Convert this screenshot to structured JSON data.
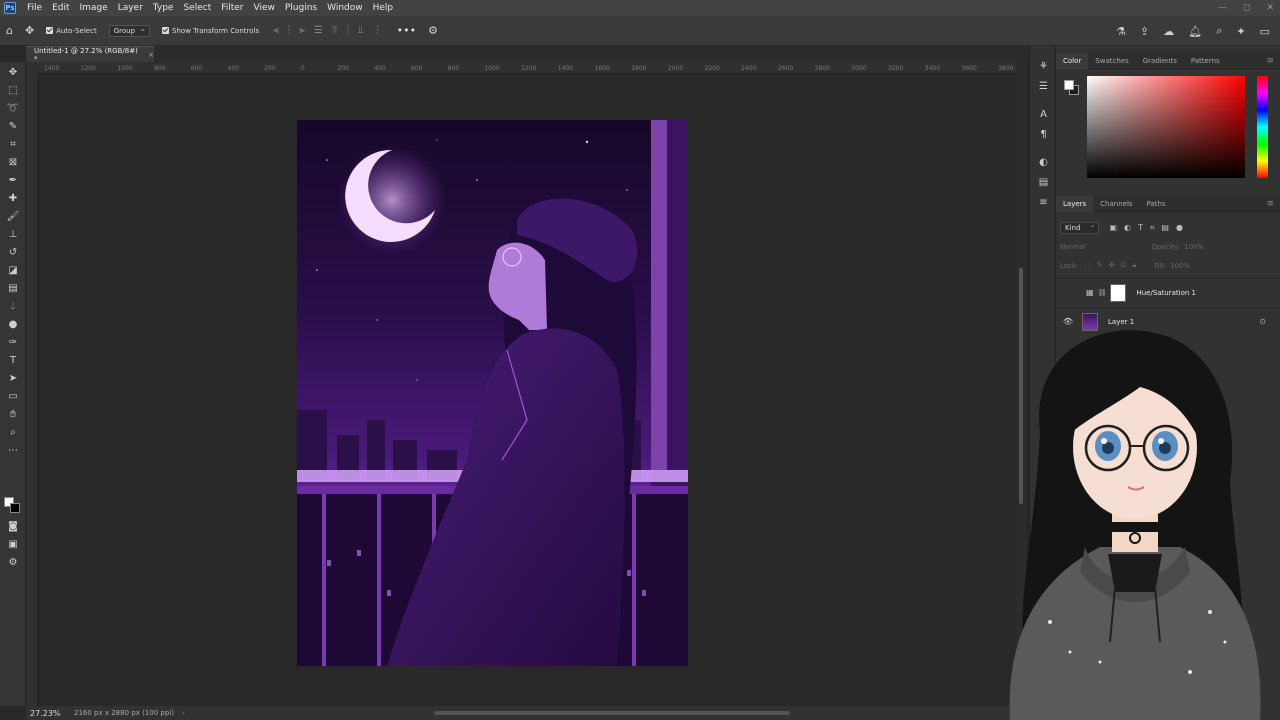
{
  "menubar": {
    "logo": "Ps",
    "items": [
      "File",
      "Edit",
      "Image",
      "Layer",
      "Type",
      "Select",
      "Filter",
      "View",
      "Plugins",
      "Window",
      "Help"
    ],
    "window_controls": [
      "—",
      "◻",
      "✕"
    ]
  },
  "optionsbar": {
    "auto_select_label": "Auto-Select",
    "auto_select_checked": true,
    "target_value": "Group",
    "transform_controls_label": "Show Transform Controls",
    "transform_controls_checked": true,
    "more_label": "•••"
  },
  "document": {
    "tab_title": "Untitled-1 @ 27.2% (RGB/8#) *",
    "close_label": "×"
  },
  "ruler": {
    "ticks": [
      "1400",
      "1200",
      "1000",
      "800",
      "600",
      "400",
      "200",
      "0",
      "200",
      "400",
      "600",
      "800",
      "1000",
      "1200",
      "1400",
      "1600",
      "1800",
      "2000",
      "2200",
      "2400",
      "2600",
      "2800",
      "3000",
      "3200",
      "3400",
      "3600",
      "3800"
    ]
  },
  "statusbar": {
    "zoom": "27.23%",
    "doc_info": "2160 px x 2880 px (100 ppi)",
    "arrow": "›"
  },
  "color_panel": {
    "tabs": [
      "Color",
      "Swatches",
      "Gradients",
      "Patterns"
    ],
    "active_tab": "Color",
    "foreground": "#ffffff",
    "background": "#1c1c1c",
    "hue_selected": "#ff0000"
  },
  "layers_panel": {
    "tabs": [
      "Layers",
      "Channels",
      "Paths"
    ],
    "active_tab": "Layers",
    "filter_kind": "Kind",
    "blend_mode": "Normal",
    "opacity_label": "Opacity:",
    "opacity_value": "100%",
    "lock_label": "Lock:",
    "fill_label": "Fill:",
    "fill_value": "100%",
    "layers": [
      {
        "name": "Hue/Saturation 1",
        "visible": false
      },
      {
        "name": "Layer 1",
        "visible": true
      }
    ]
  },
  "colors": {
    "accent": "#1473e6",
    "artwork_purple": "#5a1f8c"
  }
}
